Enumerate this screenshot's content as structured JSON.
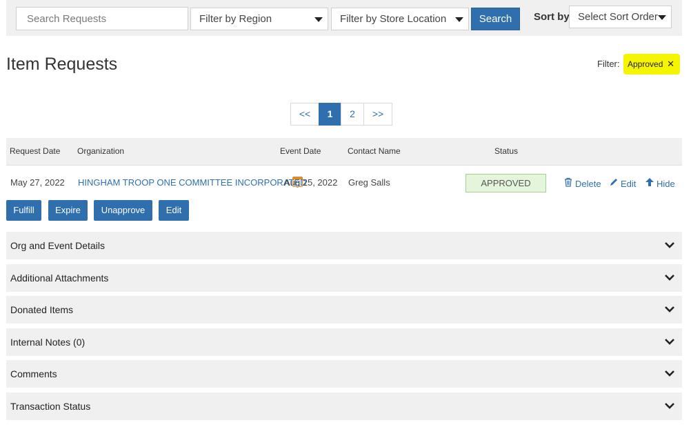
{
  "toolbar": {
    "search_placeholder": "Search Requests",
    "region_filter": "Filter by Region",
    "store_filter": "Filter by Store Location",
    "search_button": "Search",
    "sort_label": "Sort by",
    "sort_select": "Select Sort Order"
  },
  "page_title": "Item Requests",
  "filter": {
    "label": "Filter:",
    "chip": "Approved",
    "chip_close": "✕"
  },
  "pagination": {
    "prev": "<<",
    "pages": [
      "1",
      "2"
    ],
    "current": "1",
    "next": ">>"
  },
  "table": {
    "columns": [
      "Request Date",
      "Organization",
      "Event Date",
      "Contact Name",
      "Status"
    ],
    "row": {
      "request_date": "May 27, 2022",
      "organization": "HINGHAM TROOP ONE COMMITTEE INCORPORATED",
      "event_date": "Aug 25, 2022",
      "contact_name": "Greg Salls",
      "status": "APPROVED"
    },
    "row_actions": {
      "delete": "Delete",
      "edit": "Edit",
      "hide": "Hide"
    }
  },
  "actions": [
    "Fulfill",
    "Expire",
    "Unapprove",
    "Edit"
  ],
  "sections": [
    "Org and Event Details",
    "Additional Attachments",
    "Donated Items",
    "Internal Notes (0)",
    "Comments",
    "Transaction Status"
  ],
  "colors": {
    "primary": "#2f6fae",
    "highlight": "#f5f500",
    "status_bg": "#e4f5dc",
    "calendar_icon": "#e0892b"
  }
}
